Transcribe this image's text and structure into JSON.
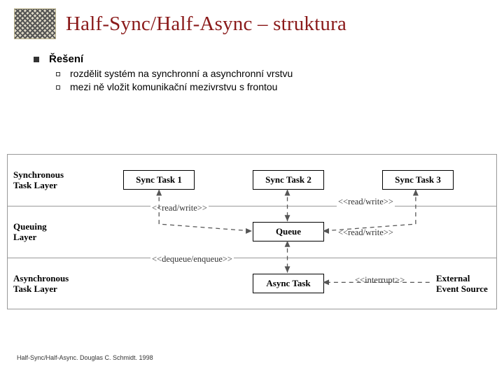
{
  "title": "Half-Sync/Half-Async – struktura",
  "bullets": {
    "heading": "Řešení",
    "items": [
      "rozdělit systém na synchronní a asynchronní vrstvu",
      "mezi ně vložit komunikační mezivrstvu s frontou"
    ]
  },
  "diagram": {
    "layers": {
      "sync": "Synchronous\nTask Layer",
      "queue": "Queuing\nLayer",
      "async": "Asynchronous\nTask Layer"
    },
    "boxes": {
      "syncTask1": "Sync Task 1",
      "syncTask2": "Sync Task 2",
      "syncTask3": "Sync Task 3",
      "queue": "Queue",
      "asyncTask": "Async Task"
    },
    "annotations": {
      "rw1": "<<read/write>>",
      "rw2": "<<read/write>>",
      "rw3": "<<read/write>>",
      "deq": "<<dequeue/enqueue>>",
      "intr": "<<interrupt>>"
    },
    "external": {
      "line1": "External",
      "line2": "Event Source"
    }
  },
  "citation": "Half-Sync/Half-Async. Douglas C. Schmidt. 1998"
}
